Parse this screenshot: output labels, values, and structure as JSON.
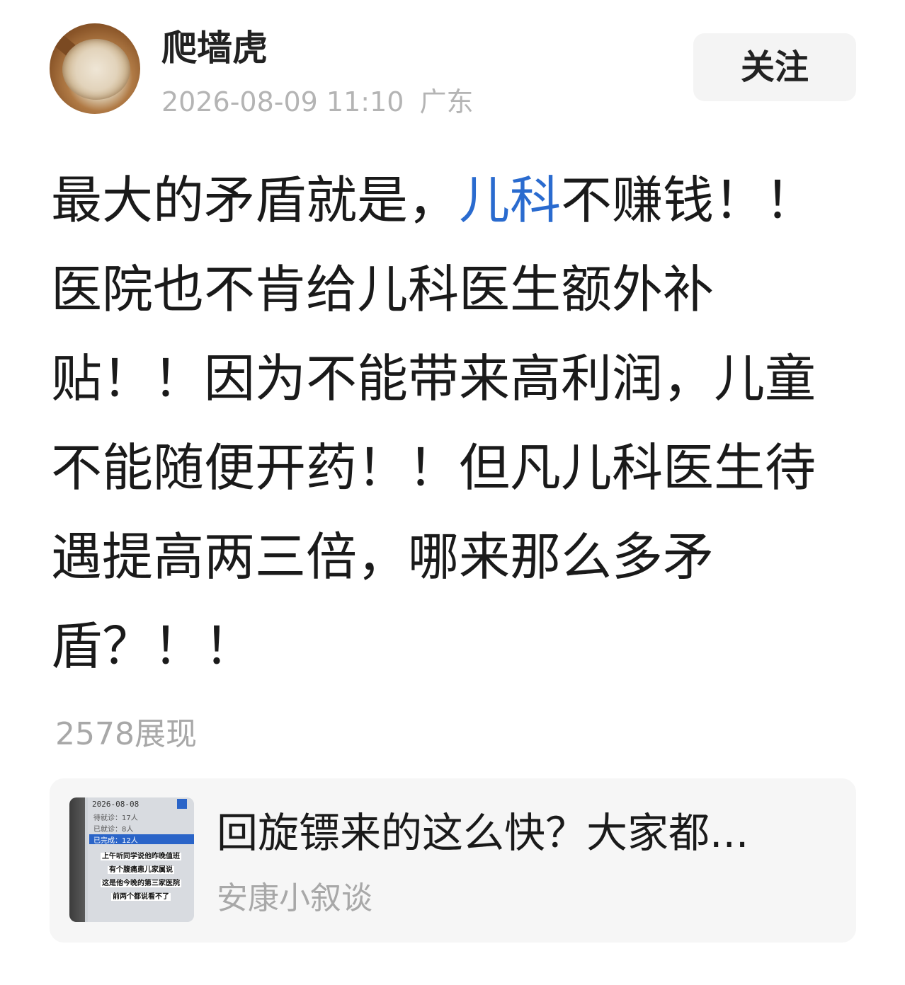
{
  "author": {
    "name": "爬墙虎",
    "timestamp": "2026-08-09 11:10",
    "location": "广东"
  },
  "follow_label": "关注",
  "post": {
    "lines": [
      {
        "before": "最大的矛盾就是，",
        "link": "儿科",
        "after": "不赚钱！！"
      },
      {
        "text": "医院也不肯给儿科医生额外补"
      },
      {
        "text": "贴！！因为不能带来高利润，儿童"
      },
      {
        "text": "不能随便开药！！但凡儿科医生待"
      },
      {
        "text": "遇提高两三倍，哪来那么多矛"
      },
      {
        "text": "盾？！！"
      }
    ],
    "views": "2578展现"
  },
  "linked_card": {
    "title": "回旋镖来的这么快？大家都...",
    "source": "安康小叙谈",
    "thumbnail": {
      "date": "2026-08-08",
      "rows": [
        "待就诊：17人",
        "已就诊：8人",
        "已完成：12人"
      ],
      "captions": [
        "上午听同学说他昨晚值班",
        "有个腹痛患儿家属说",
        "这是他今晚的第三家医院",
        "前两个都说看不了"
      ]
    }
  },
  "colors": {
    "link": "#2a6bcf",
    "muted": "#a8a8a8",
    "button_bg": "#f4f4f4",
    "card_bg": "#f6f6f6"
  }
}
